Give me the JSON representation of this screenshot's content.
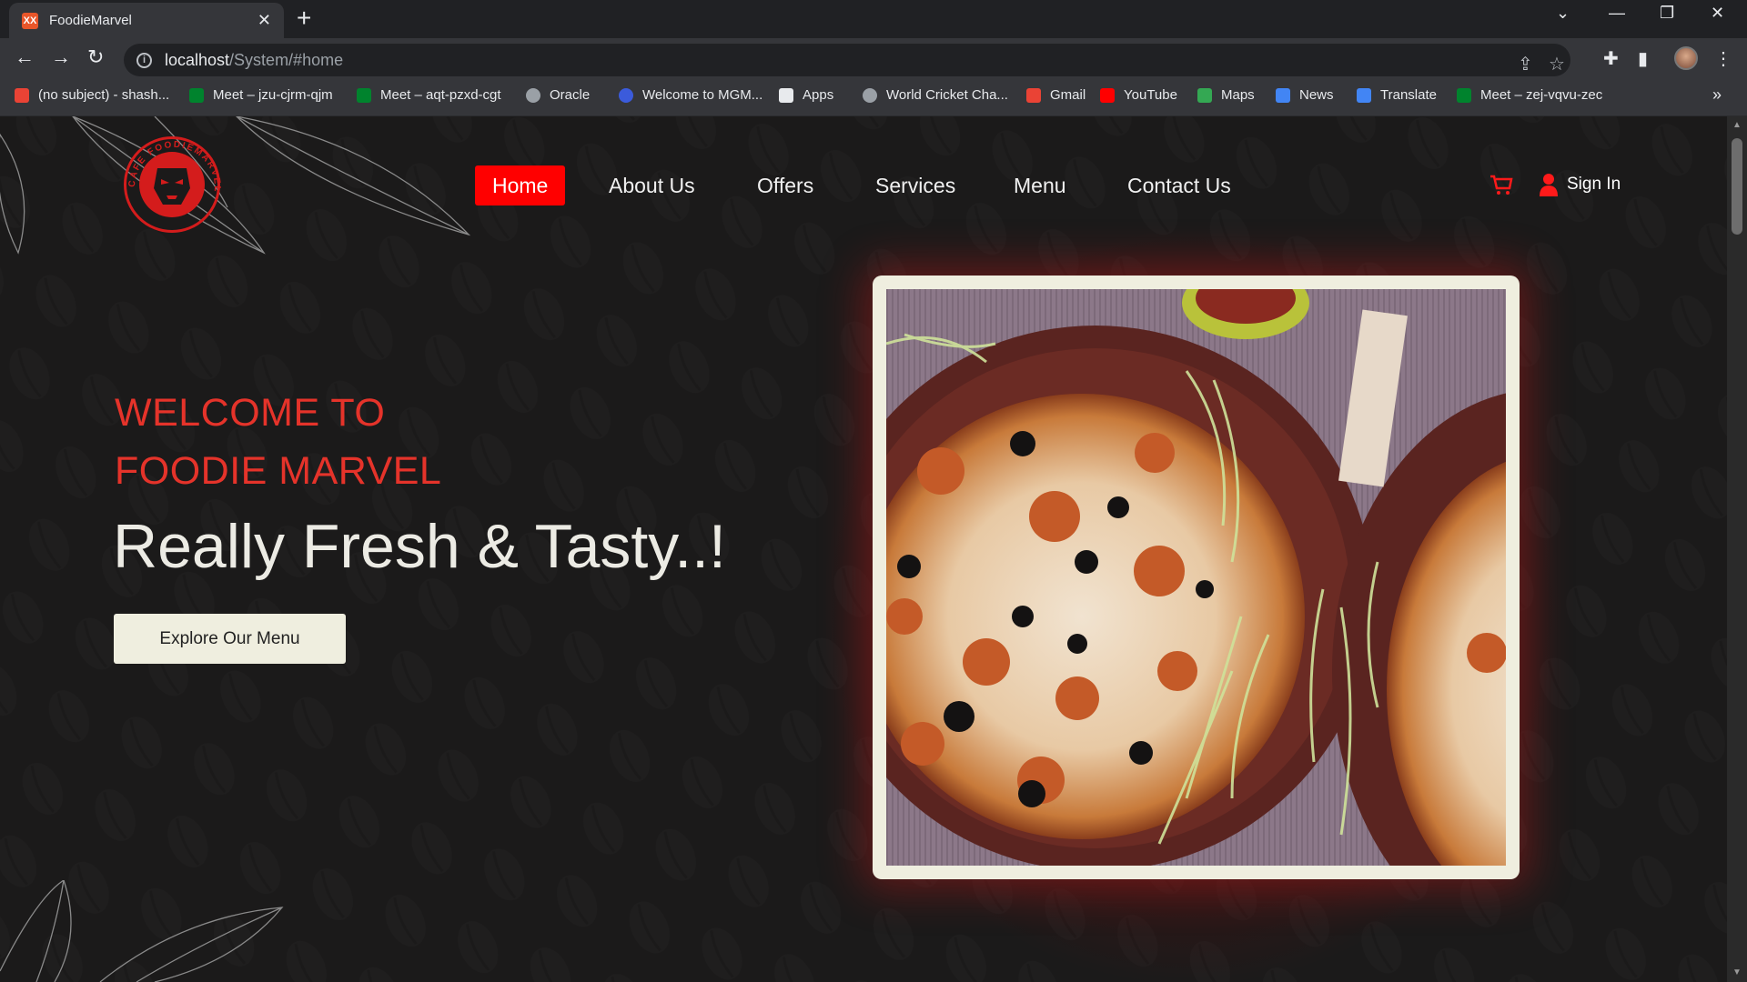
{
  "browser": {
    "tab_title": "FoodieMarvel",
    "favicon_label": "XX",
    "url_host": "localhost",
    "url_path": "/System/#home",
    "bookmarks": [
      {
        "label": "(no subject) - shash...",
        "icon": "gmail-icon",
        "color": "#ea4335"
      },
      {
        "label": "Meet – jzu-cjrm-qjm",
        "icon": "meet-icon",
        "color": "#00832d"
      },
      {
        "label": "Meet – aqt-pzxd-cgt",
        "icon": "meet-icon",
        "color": "#00832d"
      },
      {
        "label": "Oracle",
        "icon": "globe-icon",
        "color": "#9aa0a6"
      },
      {
        "label": "Welcome to MGM...",
        "icon": "globe-icon",
        "color": "#3b5bdb"
      },
      {
        "label": "Apps",
        "icon": "apps-grid-icon",
        "color": "#e8eaed"
      },
      {
        "label": "World Cricket Cha...",
        "icon": "globe-icon",
        "color": "#9aa0a6"
      },
      {
        "label": "Gmail",
        "icon": "gmail-icon",
        "color": "#ea4335"
      },
      {
        "label": "YouTube",
        "icon": "youtube-icon",
        "color": "#ff0000"
      },
      {
        "label": "Maps",
        "icon": "maps-icon",
        "color": "#34a853"
      },
      {
        "label": "News",
        "icon": "news-icon",
        "color": "#4285f4"
      },
      {
        "label": "Translate",
        "icon": "translate-icon",
        "color": "#4285f4"
      },
      {
        "label": "Meet – zej-vqvu-zec",
        "icon": "meet-icon",
        "color": "#00832d"
      }
    ]
  },
  "site": {
    "logo_text": "CAFE FOODIEMARVEL",
    "nav": [
      {
        "label": "Home",
        "active": true
      },
      {
        "label": "About Us",
        "active": false
      },
      {
        "label": "Offers",
        "active": false
      },
      {
        "label": "Services",
        "active": false
      },
      {
        "label": "Menu",
        "active": false
      },
      {
        "label": "Contact Us",
        "active": false
      }
    ],
    "signin_label": "Sign In",
    "accent_color": "#ff0000"
  },
  "hero": {
    "kicker_line1": "WELCOME TO",
    "kicker_line2": "FOODIE MARVEL",
    "title": "Really Fresh & Tasty..!",
    "button_label": "Explore Our Menu"
  }
}
